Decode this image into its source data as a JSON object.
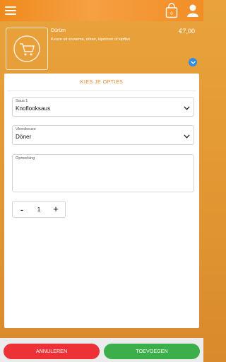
{
  "header": {
    "menu_icon": "hamburger-menu-icon",
    "cart_icon": "shopping-bag-icon",
    "cart_count": "0",
    "user_icon": "user-icon"
  },
  "product": {
    "name": "Dürüm",
    "description": "Keuze uit shoarma, döner, kipdöner of kipfilet",
    "price": "€7,00",
    "image_icon": "shopping-cart-icon",
    "expand_icon": "chevron-down-icon"
  },
  "options": {
    "title": "KIES JE OPTIES",
    "fields": [
      {
        "label": "Saus 1",
        "value": "Knoflooksaus"
      },
      {
        "label": "Vleeskeuze",
        "value": "Döner"
      }
    ],
    "remark": {
      "label": "Opmerking",
      "value": ""
    },
    "quantity": {
      "minus": "-",
      "value": "1",
      "plus": "+"
    }
  },
  "footer": {
    "cancel_label": "ANNULEREN",
    "add_label": "TOEVOEGEN"
  },
  "colors": {
    "accent": "#e9862a",
    "cancel": "#ed3237",
    "confirm": "#3cae4a",
    "expand": "#2f8de4"
  }
}
